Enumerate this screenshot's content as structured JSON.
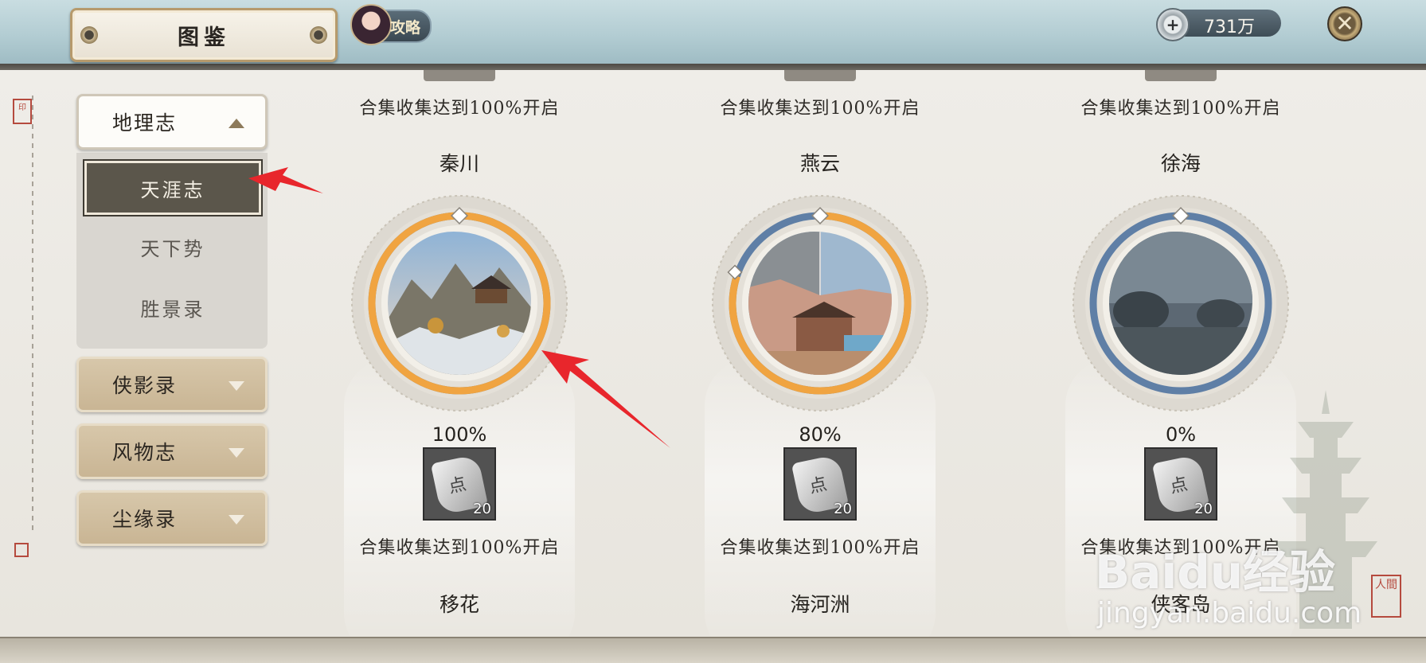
{
  "header": {
    "title": "图鉴",
    "guide_label": "攻略",
    "currency_value": "731万",
    "close_icon": "close-icon"
  },
  "sidebar": {
    "categories": [
      {
        "label": "地理志",
        "expanded": true,
        "subitems": [
          {
            "label": "天涯志",
            "selected": true
          },
          {
            "label": "天下势",
            "selected": false
          },
          {
            "label": "胜景录",
            "selected": false
          }
        ]
      },
      {
        "label": "侠影录",
        "expanded": false
      },
      {
        "label": "风物志",
        "expanded": false
      },
      {
        "label": "尘缘录",
        "expanded": false
      }
    ]
  },
  "grid": {
    "top_row_unlock": [
      "合集收集达到100%开启",
      "合集收集达到100%开启",
      "合集收集达到100%开启"
    ],
    "regions": [
      {
        "name": "秦川",
        "progress_text": "100%",
        "progress": 1.0,
        "reward_count": "20",
        "unlock_text": "合集收集达到100%开启"
      },
      {
        "name": "燕云",
        "progress_text": "80%",
        "progress": 0.8,
        "reward_count": "20",
        "unlock_text": "合集收集达到100%开启"
      },
      {
        "name": "徐海",
        "progress_text": "0%",
        "progress": 0.0,
        "reward_count": "20",
        "unlock_text": "合集收集达到100%开启"
      }
    ],
    "next_row_names": [
      "移花",
      "海河洲",
      "侠客岛"
    ],
    "reward_glyph": "点"
  },
  "watermark": {
    "main": "Baidu经验",
    "sub": "jingyan.baidu.com"
  },
  "colors": {
    "progress_fill": "#f0a441",
    "progress_track": "#5f7fa6",
    "selected_item_bg": "#5b564b",
    "arrow_red": "#e8262c"
  }
}
